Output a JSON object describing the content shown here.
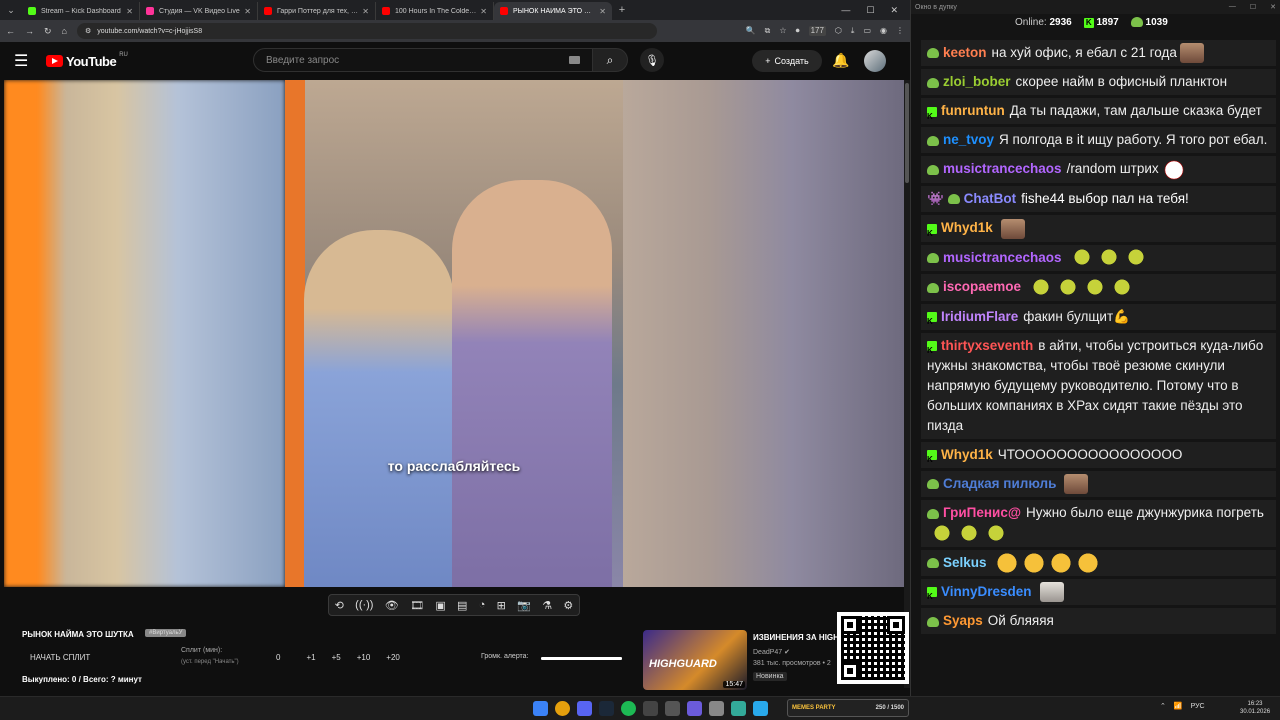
{
  "browser": {
    "tabs": [
      {
        "title": "Stream – Kick Dashboard",
        "color": "#53fc18"
      },
      {
        "title": "Студия — VK Видео Live",
        "color": "#ff3399"
      },
      {
        "title": "Гарри Поттер для тех, кто вы…",
        "color": "#ff0000"
      },
      {
        "title": "100 Hours In The Coldest City",
        "color": "#ff0000"
      },
      {
        "title": "РЫНОК НАЙМА ЭТО ШУТ…",
        "color": "#ff0000",
        "active": true
      }
    ],
    "url": "youtube.com/watch?v=c-jHojjisS8",
    "ext_badge": "177"
  },
  "youtube": {
    "logo": "YouTube",
    "region": "RU",
    "search_placeholder": "Введите запрос",
    "create_label": "Создать",
    "video_caption": "то расслабляйтесь"
  },
  "panel": {
    "title": "РЫНОК НАЙМА ЭТО ШУТКА",
    "tag": "#ВиртуальУ",
    "split_button": "НАЧАТЬ СПЛИТ",
    "split_label": "Сплит (мин):",
    "split_sub": "(уст. перед \"Начать\")",
    "split_value": "0",
    "increments": [
      "+1",
      "+5",
      "+10",
      "+20"
    ],
    "bought": "Выкуплено: 0 / Всего: ? минут",
    "alert_label": "Громк. алерта:",
    "alert_volume": 1.0
  },
  "recommended": {
    "thumb_text": "HIGHGUARD",
    "duration": "15:47",
    "title": "ИЗВИНЕНИЯ ЗА HIGH",
    "channel": "DeadP47",
    "views": "381 тыс. просмотров • 2",
    "badge": "Новинка"
  },
  "chat": {
    "window_title": "Окно в дупку",
    "online_label": "Online:",
    "online": "2936",
    "kick_count": "1897",
    "vk_count": "1039",
    "messages": [
      {
        "user": "keeton",
        "color": "#ff7f50",
        "badge": "pepe",
        "text": "на хуй офис, я ебал с 21 года",
        "emotes": [
          "face"
        ]
      },
      {
        "user": "zloi_bober",
        "color": "#9acd32",
        "badge": "pepe",
        "text": "скорее найм в офисный планктон",
        "emotes": []
      },
      {
        "user": "funruntun",
        "color": "#ffb347",
        "badge": "kick",
        "text": "Да ты падажи, там дальше сказка будет",
        "emotes": []
      },
      {
        "user": "ne_tvoy",
        "color": "#1e90ff",
        "badge": "pepe",
        "text": "Я полгода в it ищу работу. Я того рот ебал.",
        "emotes": []
      },
      {
        "user": "musictrancechaos",
        "color": "#b266ff",
        "badge": "pepe",
        "text": "/random штрих",
        "emotes": [
          "mask"
        ]
      },
      {
        "user": "ChatBot",
        "color": "#8a8aff",
        "badge": "bot",
        "text": "fishe44 выбор пал на тебя!",
        "mention": "fishe44",
        "emotes": []
      },
      {
        "user": "Whyd1k",
        "color": "#ffb347",
        "badge": "kick",
        "text": "",
        "emotes": [
          "face"
        ]
      },
      {
        "user": "musictrancechaos",
        "color": "#b266ff",
        "badge": "pepe",
        "text": "",
        "emotes": [
          "pepe",
          "pepe",
          "pepe"
        ]
      },
      {
        "user": "iscopaemoe",
        "color": "#ff69b4",
        "badge": "pepe",
        "text": "",
        "emotes": [
          "pepe",
          "pepe",
          "pepe",
          "pepe"
        ]
      },
      {
        "user": "IridiumFlare",
        "color": "#c084fc",
        "badge": "kick",
        "text": "факин булщит💪",
        "emotes": []
      },
      {
        "user": "thirtyxseventh",
        "color": "#ff5555",
        "badge": "kick",
        "text": "в айти, чтобы устроиться куда-либо нужны знакомства, чтобы твоё резюме скинули напрямую будущему руководителю. Потому что в больших компаниях в ХРах сидят такие пёзды это пизда",
        "emotes": []
      },
      {
        "user": "Whyd1k",
        "color": "#ffb347",
        "badge": "kick",
        "text": "ЧТОООООООООООООООО",
        "emotes": []
      },
      {
        "user": "Сладкая пилюль",
        "color": "#4f7dd6",
        "badge": "pepe",
        "text": "",
        "emotes": [
          "face"
        ]
      },
      {
        "user": "ГриПенис@",
        "color": "#ff4fa3",
        "badge": "pepe",
        "text": "Нужно было еще джунжурика погреть",
        "emotes": [
          "pepe",
          "pepe",
          "pepe"
        ]
      },
      {
        "user": "Selkus",
        "color": "#7bd1ff",
        "badge": "pepe",
        "text": "",
        "emotes": [
          "laugh",
          "laugh",
          "laugh",
          "laugh"
        ]
      },
      {
        "user": "VinnyDresden",
        "color": "#3a8dff",
        "badge": "kick",
        "text": "",
        "emotes": [
          "cat"
        ]
      },
      {
        "user": "Syaps",
        "color": "#ff9933",
        "badge": "pepe",
        "text": "Ой бляяяя",
        "emotes": []
      }
    ]
  },
  "taskbar": {
    "memes_title": "MEMES PARTY",
    "memes_count": "250 / 1500",
    "lang": "РУС",
    "time": "16:23",
    "date": "30.01.2026"
  }
}
